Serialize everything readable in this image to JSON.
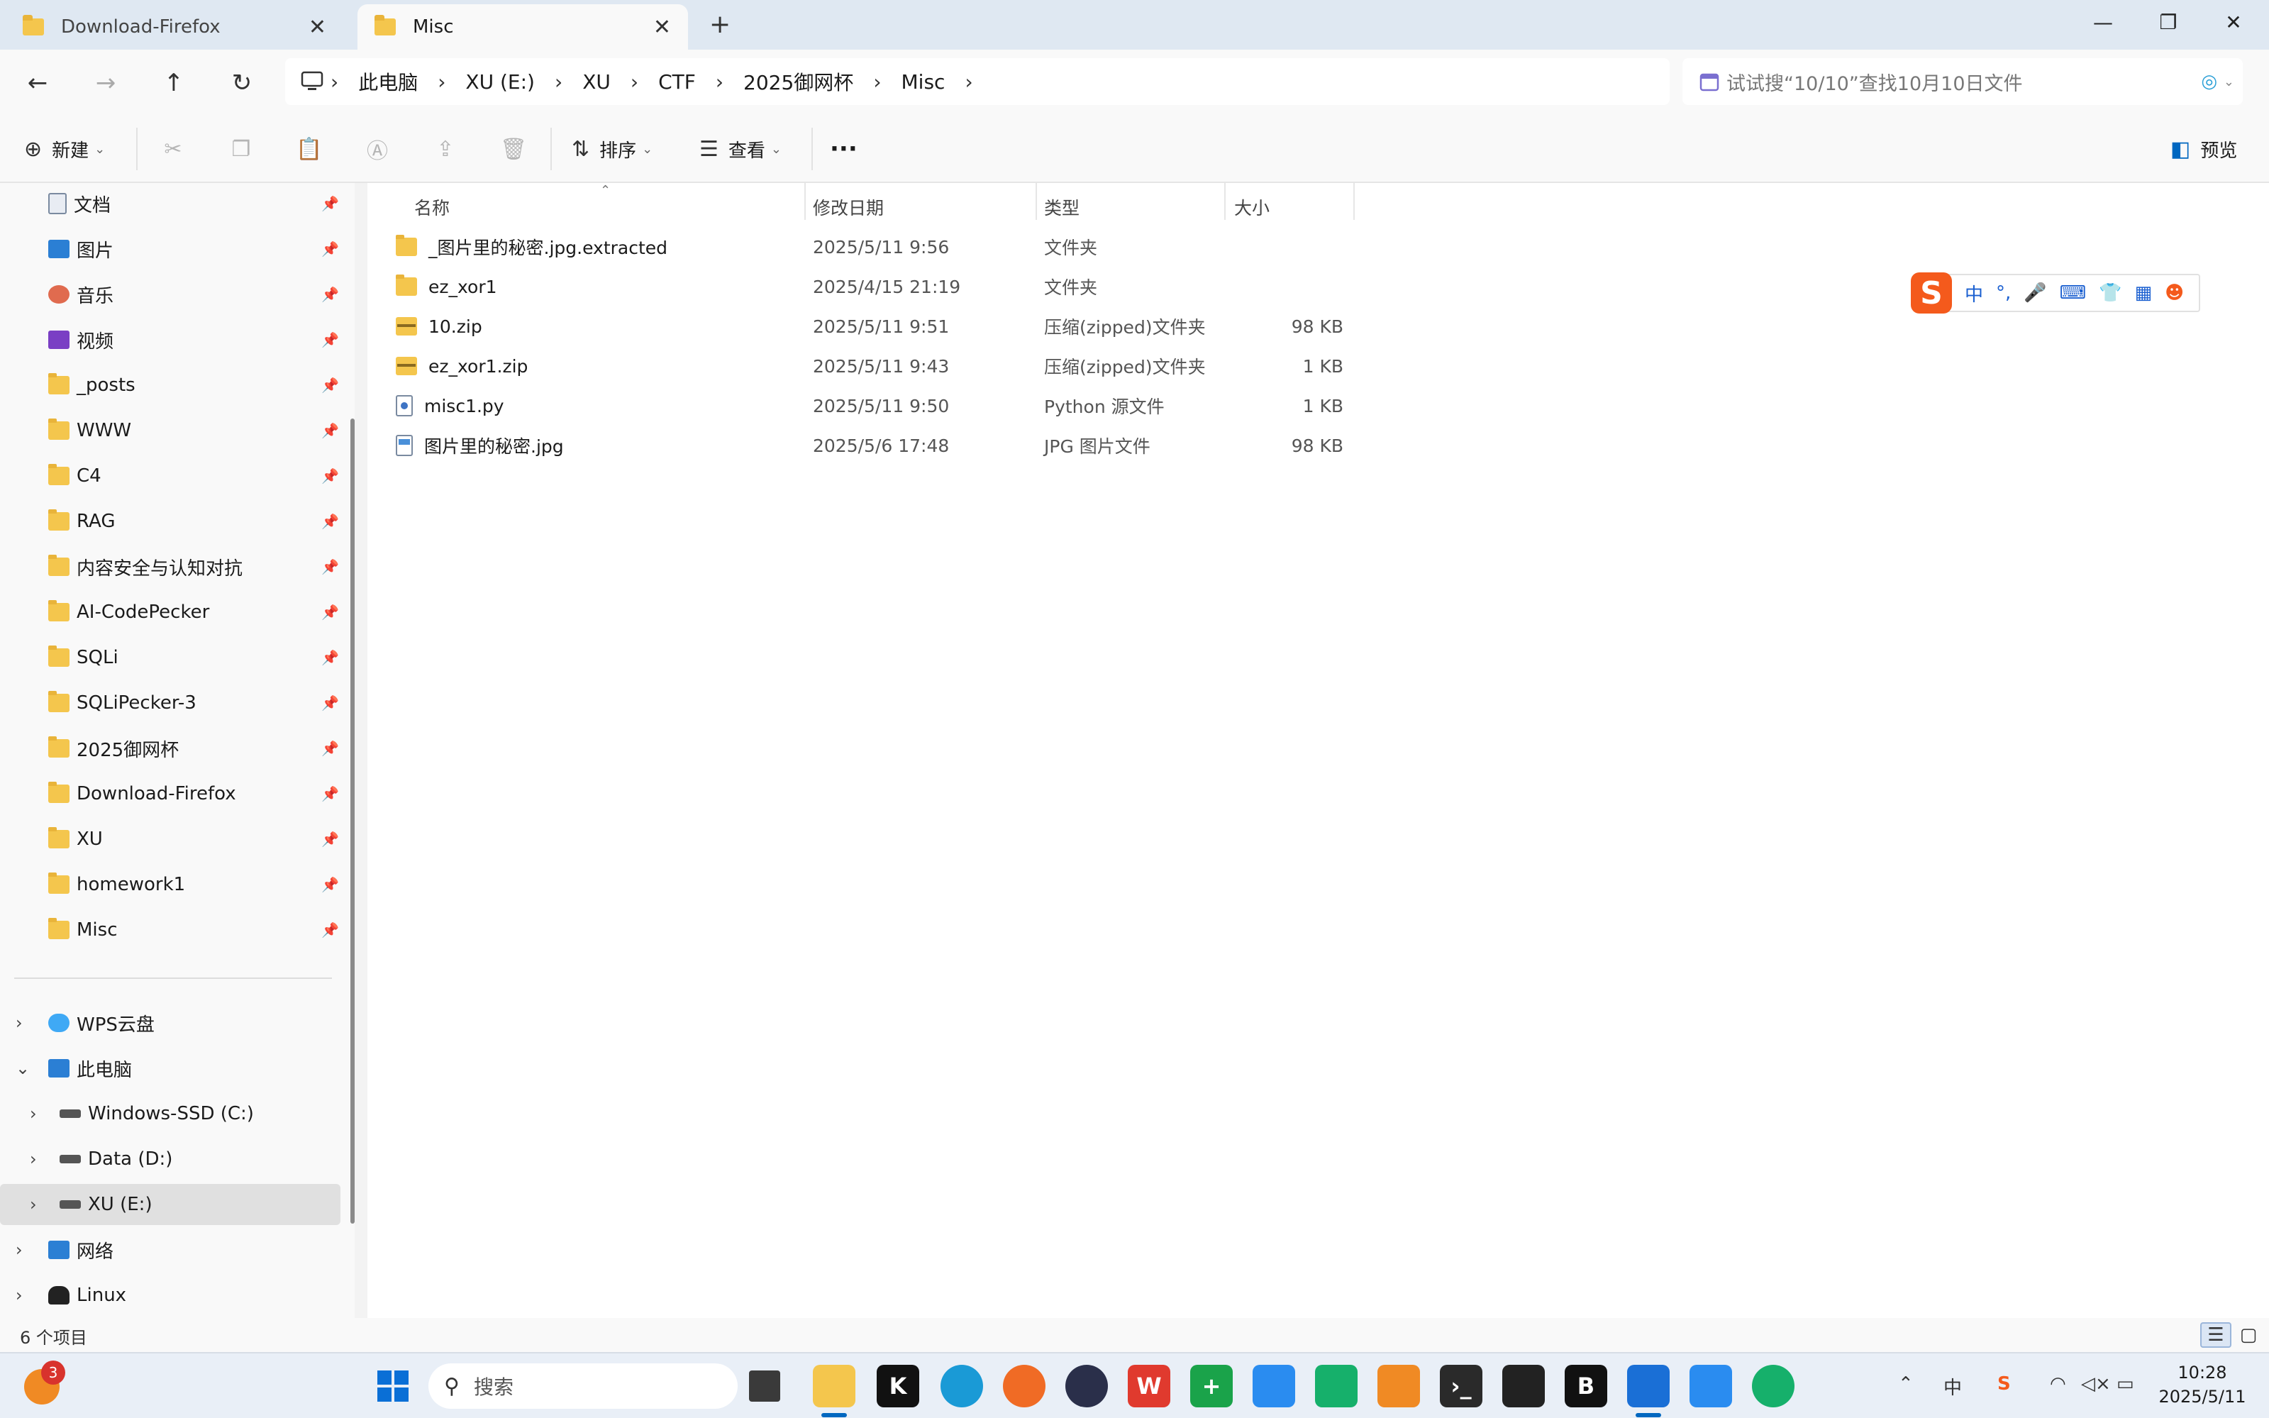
{
  "tabs": [
    {
      "label": "Download-Firefox",
      "close": "✕"
    },
    {
      "label": "Misc",
      "close": "✕"
    }
  ],
  "new_tab": "+",
  "window_controls": {
    "minimize": "—",
    "maximize": "❐",
    "close": "✕"
  },
  "nav": {
    "back": "←",
    "forward": "→",
    "up": "↑",
    "refresh": "↻"
  },
  "breadcrumbs": [
    "此电脑",
    "XU (E:)",
    "XU",
    "CTF",
    "2025御网杯",
    "Misc"
  ],
  "search": {
    "placeholder": "试试搜“10/10”查找10月10日文件"
  },
  "toolbar": {
    "new_label": "新建",
    "sort_label": "排序",
    "view_label": "查看",
    "more_label": "···",
    "preview_label": "预览"
  },
  "sidebar": {
    "quick_access": [
      {
        "label": "文档",
        "icon": "documents-icon"
      },
      {
        "label": "图片",
        "icon": "pictures-icon"
      },
      {
        "label": "音乐",
        "icon": "music-icon"
      },
      {
        "label": "视频",
        "icon": "videos-icon"
      },
      {
        "label": "_posts",
        "icon": "folder-icon"
      },
      {
        "label": "WWW",
        "icon": "folder-icon"
      },
      {
        "label": "C4",
        "icon": "folder-icon"
      },
      {
        "label": "RAG",
        "icon": "folder-icon"
      },
      {
        "label": "内容安全与认知对抗",
        "icon": "folder-icon"
      },
      {
        "label": "AI-CodePecker",
        "icon": "folder-icon"
      },
      {
        "label": "SQLi",
        "icon": "folder-icon"
      },
      {
        "label": "SQLiPecker-3",
        "icon": "folder-icon"
      },
      {
        "label": "2025御网杯",
        "icon": "folder-icon"
      },
      {
        "label": "Download-Firefox",
        "icon": "folder-icon"
      },
      {
        "label": "XU",
        "icon": "folder-icon"
      },
      {
        "label": "homework1",
        "icon": "folder-icon"
      },
      {
        "label": "Misc",
        "icon": "folder-icon"
      }
    ],
    "tree": {
      "wps": "WPS云盘",
      "this_pc": "此电脑",
      "drive_c": "Windows-SSD (C:)",
      "drive_d": "Data (D:)",
      "drive_e": "XU (E:)",
      "network": "网络",
      "linux": "Linux"
    }
  },
  "columns": {
    "name": "名称",
    "date": "修改日期",
    "type": "类型",
    "size": "大小"
  },
  "files": [
    {
      "name": "_图片里的秘密.jpg.extracted",
      "date": "2025/5/11 9:56",
      "type": "文件夹",
      "size": "",
      "icon": "folder-icon"
    },
    {
      "name": "ez_xor1",
      "date": "2025/4/15 21:19",
      "type": "文件夹",
      "size": "",
      "icon": "folder-icon"
    },
    {
      "name": "10.zip",
      "date": "2025/5/11 9:51",
      "type": "压缩(zipped)文件夹",
      "size": "98 KB",
      "icon": "zip-icon"
    },
    {
      "name": "ez_xor1.zip",
      "date": "2025/5/11 9:43",
      "type": "压缩(zipped)文件夹",
      "size": "1 KB",
      "icon": "zip-icon"
    },
    {
      "name": "misc1.py",
      "date": "2025/5/11 9:50",
      "type": "Python 源文件",
      "size": "1 KB",
      "icon": "python-file-icon"
    },
    {
      "name": "图片里的秘密.jpg",
      "date": "2025/5/6 17:48",
      "type": "JPG 图片文件",
      "size": "98 KB",
      "icon": "jpg-file-icon"
    }
  ],
  "ime": {
    "logo": "S",
    "mode": "中",
    "punct": "°,",
    "mic": "🎤",
    "keyboard": "⌨",
    "skin": "👕",
    "tools": "▦",
    "mascot": "☻"
  },
  "status": {
    "item_count": "6 个项目"
  },
  "taskbar": {
    "search_label": "搜索",
    "notification_count": "3",
    "clock_time": "10:28",
    "clock_date": "2025/5/11",
    "tray_ime": "中",
    "tray_sogou": "S"
  },
  "colors": {
    "accent": "#0067c0",
    "folder": "#f4c64d",
    "sogou": "#f45a1c"
  }
}
